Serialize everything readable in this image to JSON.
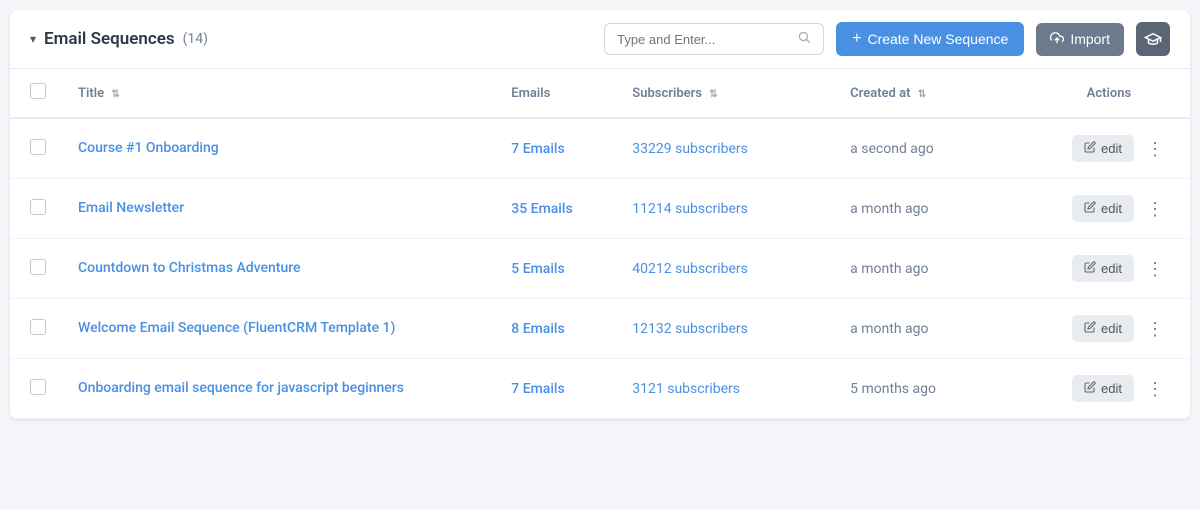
{
  "header": {
    "title": "Email Sequences",
    "count": "(14)",
    "search_placeholder": "Type and Enter...",
    "btn_create_label": "Create New Sequence",
    "btn_import_label": "Import"
  },
  "table": {
    "columns": [
      {
        "key": "checkbox",
        "label": ""
      },
      {
        "key": "title",
        "label": "Title"
      },
      {
        "key": "emails",
        "label": "Emails"
      },
      {
        "key": "subscribers",
        "label": "Subscribers"
      },
      {
        "key": "created_at",
        "label": "Created at"
      },
      {
        "key": "actions",
        "label": "Actions"
      }
    ],
    "rows": [
      {
        "title": "Course #1 Onboarding",
        "emails": "7 Emails",
        "subscribers": "33229 subscribers",
        "created_at": "a second ago"
      },
      {
        "title": "Email Newsletter",
        "emails": "35 Emails",
        "subscribers": "11214 subscribers",
        "created_at": "a month ago"
      },
      {
        "title": "Countdown to Christmas Adventure",
        "emails": "5 Emails",
        "subscribers": "40212 subscribers",
        "created_at": "a month ago"
      },
      {
        "title": "Welcome Email Sequence (FluentCRM Template 1)",
        "emails": "8 Emails",
        "subscribers": "12132 subscribers",
        "created_at": "a month ago"
      },
      {
        "title": "Onboarding email sequence for javascript beginners",
        "emails": "7 Emails",
        "subscribers": "3121 subscribers",
        "created_at": "5 months ago"
      }
    ],
    "edit_btn_label": "edit",
    "sort_icon": "⇅"
  }
}
